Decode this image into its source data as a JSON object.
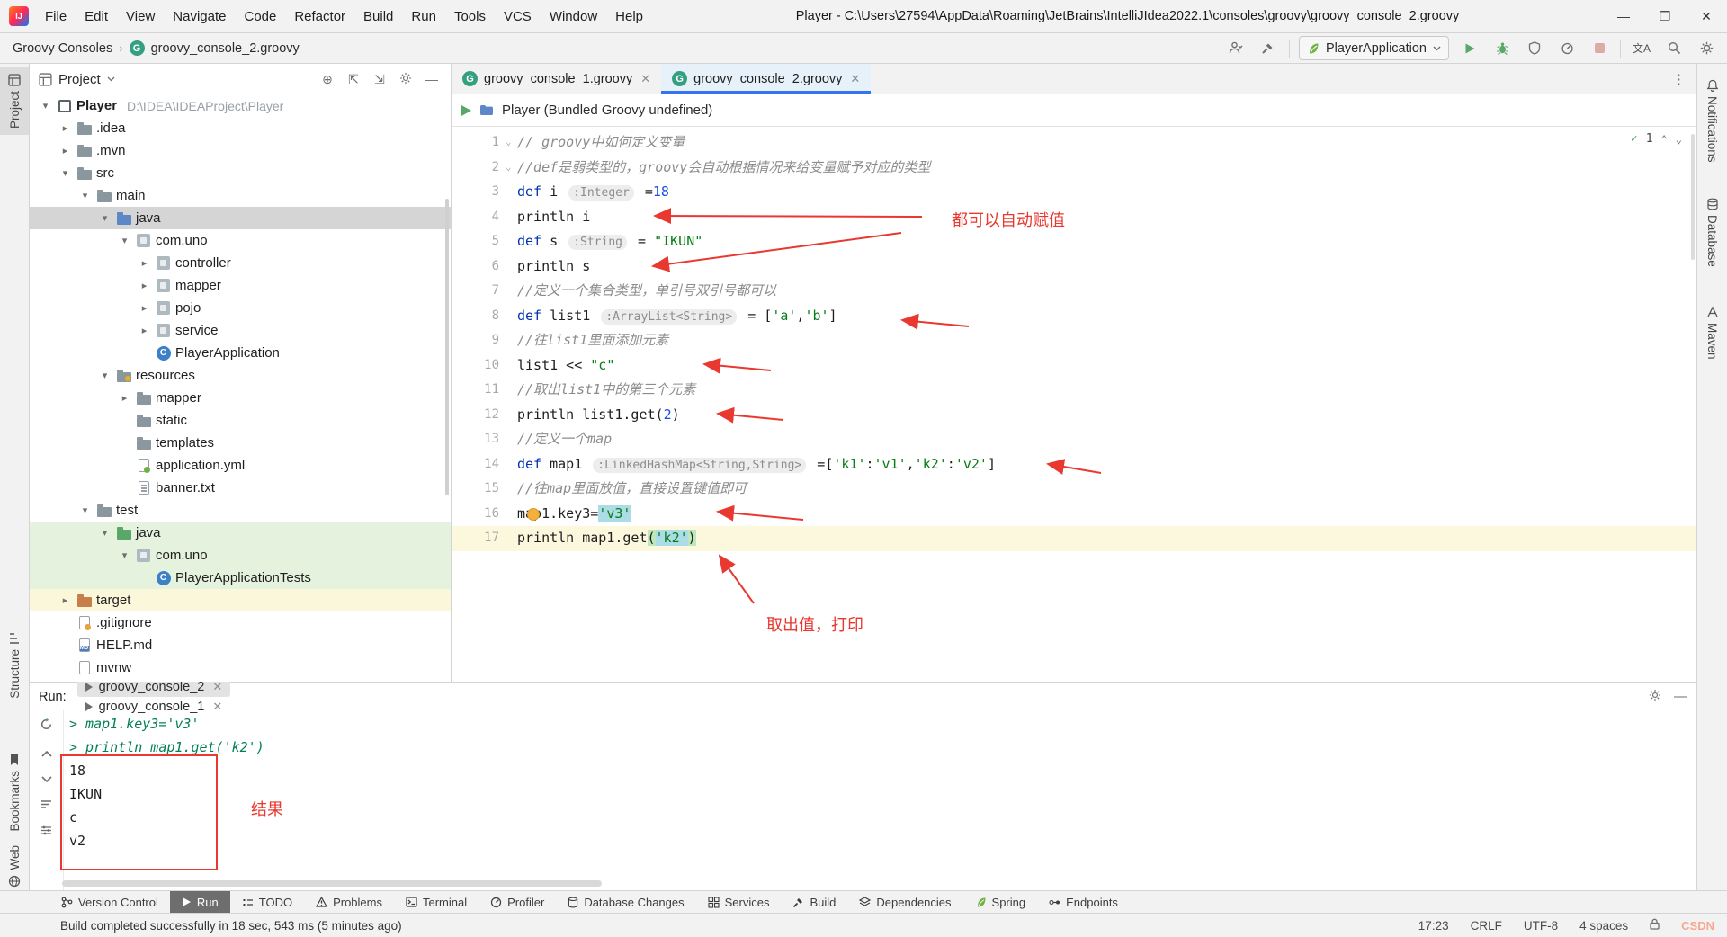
{
  "titlebar": {
    "menus": [
      "File",
      "Edit",
      "View",
      "Navigate",
      "Code",
      "Refactor",
      "Build",
      "Run",
      "Tools",
      "VCS",
      "Window",
      "Help"
    ],
    "title": "Player - C:\\Users\\27594\\AppData\\Roaming\\JetBrains\\IntelliJIdea2022.1\\consoles\\groovy\\groovy_console_2.groovy"
  },
  "navbar": {
    "breadcrumb": [
      "Groovy Consoles",
      "groovy_console_2.groovy"
    ],
    "run_config": "PlayerApplication",
    "translate_icon_text": "文A"
  },
  "left_strip": {
    "top": "Project",
    "middle": "Structure",
    "bottom1": "Bookmarks",
    "bottom2": "Web"
  },
  "right_strip": [
    "Notifications",
    "Database",
    "Maven"
  ],
  "project": {
    "header": "Project",
    "tree": [
      {
        "level": 0,
        "chev": "v",
        "icon": "module",
        "label": "Player",
        "extra": "D:\\IDEA\\IDEAProject\\Player",
        "bold": true
      },
      {
        "level": 1,
        "chev": ">",
        "icon": "folder",
        "label": ".idea"
      },
      {
        "level": 1,
        "chev": ">",
        "icon": "folder",
        "label": ".mvn"
      },
      {
        "level": 1,
        "chev": "v",
        "icon": "folder",
        "label": "src"
      },
      {
        "level": 2,
        "chev": "v",
        "icon": "folder",
        "label": "main"
      },
      {
        "level": 3,
        "chev": "v",
        "icon": "folder-src",
        "label": "java",
        "bg": "sel"
      },
      {
        "level": 4,
        "chev": "v",
        "icon": "package",
        "label": "com.uno"
      },
      {
        "level": 5,
        "chev": ">",
        "icon": "package",
        "label": "controller"
      },
      {
        "level": 5,
        "chev": ">",
        "icon": "package",
        "label": "mapper"
      },
      {
        "level": 5,
        "chev": ">",
        "icon": "package",
        "label": "pojo"
      },
      {
        "level": 5,
        "chev": ">",
        "icon": "package",
        "label": "service"
      },
      {
        "level": 5,
        "chev": "",
        "icon": "class",
        "label": "PlayerApplication"
      },
      {
        "level": 3,
        "chev": "v",
        "icon": "folder-res",
        "label": "resources"
      },
      {
        "level": 4,
        "chev": ">",
        "icon": "folder",
        "label": "mapper"
      },
      {
        "level": 4,
        "chev": "",
        "icon": "folder",
        "label": "static"
      },
      {
        "level": 4,
        "chev": "",
        "icon": "folder",
        "label": "templates"
      },
      {
        "level": 4,
        "chev": "",
        "icon": "yml",
        "label": "application.yml"
      },
      {
        "level": 4,
        "chev": "",
        "icon": "txt",
        "label": "banner.txt"
      },
      {
        "level": 2,
        "chev": "v",
        "icon": "folder",
        "label": "test"
      },
      {
        "level": 3,
        "chev": "v",
        "icon": "folder-test",
        "label": "java",
        "bg": "green"
      },
      {
        "level": 4,
        "chev": "v",
        "icon": "package",
        "label": "com.uno",
        "bg": "green"
      },
      {
        "level": 5,
        "chev": "",
        "icon": "class",
        "label": "PlayerApplicationTests",
        "bg": "green"
      },
      {
        "level": 1,
        "chev": ">",
        "icon": "folder-excl",
        "label": "target",
        "bg": "yellow"
      },
      {
        "level": 1,
        "chev": "",
        "icon": "gitignore",
        "label": ".gitignore"
      },
      {
        "level": 1,
        "chev": "",
        "icon": "md",
        "label": "HELP.md"
      },
      {
        "level": 1,
        "chev": "",
        "icon": "file",
        "label": "mvnw"
      }
    ]
  },
  "editor": {
    "tabs": [
      {
        "label": "groovy_console_1.groovy",
        "active": false
      },
      {
        "label": "groovy_console_2.groovy",
        "active": true
      }
    ],
    "header": "Player (Bundled Groovy undefined)",
    "inspections_count": "1",
    "annotations": {
      "label1": "都可以自动赋值",
      "label2": "取出值，打印"
    },
    "lines": [
      {
        "n": 1,
        "fold": true,
        "segs": [
          {
            "t": "// groovy中如何定义变量",
            "c": "com"
          }
        ]
      },
      {
        "n": 2,
        "fold": true,
        "segs": [
          {
            "t": "//def是弱类型的，groovy会自动根据情况来给变量赋予对应的类型",
            "c": "com"
          }
        ]
      },
      {
        "n": 3,
        "segs": [
          {
            "t": "def ",
            "c": "kw"
          },
          {
            "t": "i ",
            "c": "pl"
          },
          {
            "t": ":Integer",
            "c": "hint"
          },
          {
            "t": " =",
            "c": "pl"
          },
          {
            "t": "18",
            "c": "num"
          }
        ]
      },
      {
        "n": 4,
        "segs": [
          {
            "t": "println i",
            "c": "pl"
          }
        ]
      },
      {
        "n": 5,
        "segs": [
          {
            "t": "def ",
            "c": "kw"
          },
          {
            "t": "s ",
            "c": "pl"
          },
          {
            "t": ":String",
            "c": "hint"
          },
          {
            "t": " = ",
            "c": "pl"
          },
          {
            "t": "\"IKUN\"",
            "c": "str"
          }
        ]
      },
      {
        "n": 6,
        "segs": [
          {
            "t": "println s",
            "c": "pl"
          }
        ]
      },
      {
        "n": 7,
        "segs": [
          {
            "t": "//定义一个集合类型，单引号双引号都可以",
            "c": "com"
          }
        ]
      },
      {
        "n": 8,
        "segs": [
          {
            "t": "def ",
            "c": "kw"
          },
          {
            "t": "list1 ",
            "c": "pl"
          },
          {
            "t": ":ArrayList<String>",
            "c": "hint"
          },
          {
            "t": " = [",
            "c": "pl"
          },
          {
            "t": "'a'",
            "c": "str"
          },
          {
            "t": ",",
            "c": "pl"
          },
          {
            "t": "'b'",
            "c": "str"
          },
          {
            "t": "]",
            "c": "pl"
          }
        ]
      },
      {
        "n": 9,
        "segs": [
          {
            "t": "//往list1里面添加元素",
            "c": "com"
          }
        ]
      },
      {
        "n": 10,
        "segs": [
          {
            "t": "list1 << ",
            "c": "pl"
          },
          {
            "t": "\"c\"",
            "c": "str"
          }
        ]
      },
      {
        "n": 11,
        "segs": [
          {
            "t": "//取出list1中的第三个元素",
            "c": "com"
          }
        ]
      },
      {
        "n": 12,
        "segs": [
          {
            "t": "println list1.get(",
            "c": "pl"
          },
          {
            "t": "2",
            "c": "num"
          },
          {
            "t": ")",
            "c": "pl"
          }
        ]
      },
      {
        "n": 13,
        "segs": [
          {
            "t": "//定义一个map",
            "c": "com"
          }
        ]
      },
      {
        "n": 14,
        "segs": [
          {
            "t": "def ",
            "c": "kw"
          },
          {
            "t": "map1 ",
            "c": "pl"
          },
          {
            "t": ":LinkedHashMap<String,String>",
            "c": "hint"
          },
          {
            "t": " =[",
            "c": "pl"
          },
          {
            "t": "'k1'",
            "c": "str"
          },
          {
            "t": ":",
            "c": "pl"
          },
          {
            "t": "'v1'",
            "c": "str"
          },
          {
            "t": ",",
            "c": "pl"
          },
          {
            "t": "'k2'",
            "c": "str"
          },
          {
            "t": ":",
            "c": "pl"
          },
          {
            "t": "'v2'",
            "c": "str"
          },
          {
            "t": "]",
            "c": "pl"
          }
        ]
      },
      {
        "n": 15,
        "segs": [
          {
            "t": "//往map里面放值，直接设置键值即可",
            "c": "com"
          }
        ]
      },
      {
        "n": 16,
        "bulb": true,
        "segs": [
          {
            "t": "map1.key3=",
            "c": "pl"
          },
          {
            "t": "'v3'",
            "c": "str hl-sel"
          }
        ]
      },
      {
        "n": 17,
        "current": true,
        "segs": [
          {
            "t": "println map1.get",
            "c": "pl"
          },
          {
            "t": "(",
            "c": "pl hl-brace"
          },
          {
            "t": "'k2'",
            "c": "str hl-sel"
          },
          {
            "t": ")",
            "c": "pl hl-brace"
          }
        ]
      }
    ]
  },
  "run": {
    "label": "Run:",
    "tabs": [
      {
        "label": "groovy_console_2",
        "active": true
      },
      {
        "label": "groovy_console_1",
        "active": false
      }
    ],
    "output": [
      {
        "t": "> map1.key3='v3'",
        "c": "o-cmd"
      },
      {
        "t": "> println map1.get('k2')",
        "c": "o-cmd"
      },
      {
        "t": "18",
        "c": "o-res"
      },
      {
        "t": "IKUN",
        "c": "o-res"
      },
      {
        "t": "c",
        "c": "o-res"
      },
      {
        "t": "v2",
        "c": "o-res"
      }
    ],
    "result_label": "结果"
  },
  "toolbar": [
    {
      "label": "Version Control",
      "icon": "vcs"
    },
    {
      "label": "Run",
      "icon": "run",
      "active": true
    },
    {
      "label": "TODO",
      "icon": "todo"
    },
    {
      "label": "Problems",
      "icon": "problems"
    },
    {
      "label": "Terminal",
      "icon": "terminal"
    },
    {
      "label": "Profiler",
      "icon": "profiler"
    },
    {
      "label": "Database Changes",
      "icon": "db"
    },
    {
      "label": "Services",
      "icon": "services"
    },
    {
      "label": "Build",
      "icon": "build"
    },
    {
      "label": "Dependencies",
      "icon": "deps"
    },
    {
      "label": "Spring",
      "icon": "spring"
    },
    {
      "label": "Endpoints",
      "icon": "endpoints"
    }
  ],
  "statusbar": {
    "message": "Build completed successfully in 18 sec, 543 ms (5 minutes ago)",
    "time": "17:23",
    "line_sep": "CRLF",
    "encoding": "UTF-8",
    "indent": "4 spaces",
    "watermark": "CSDN"
  }
}
